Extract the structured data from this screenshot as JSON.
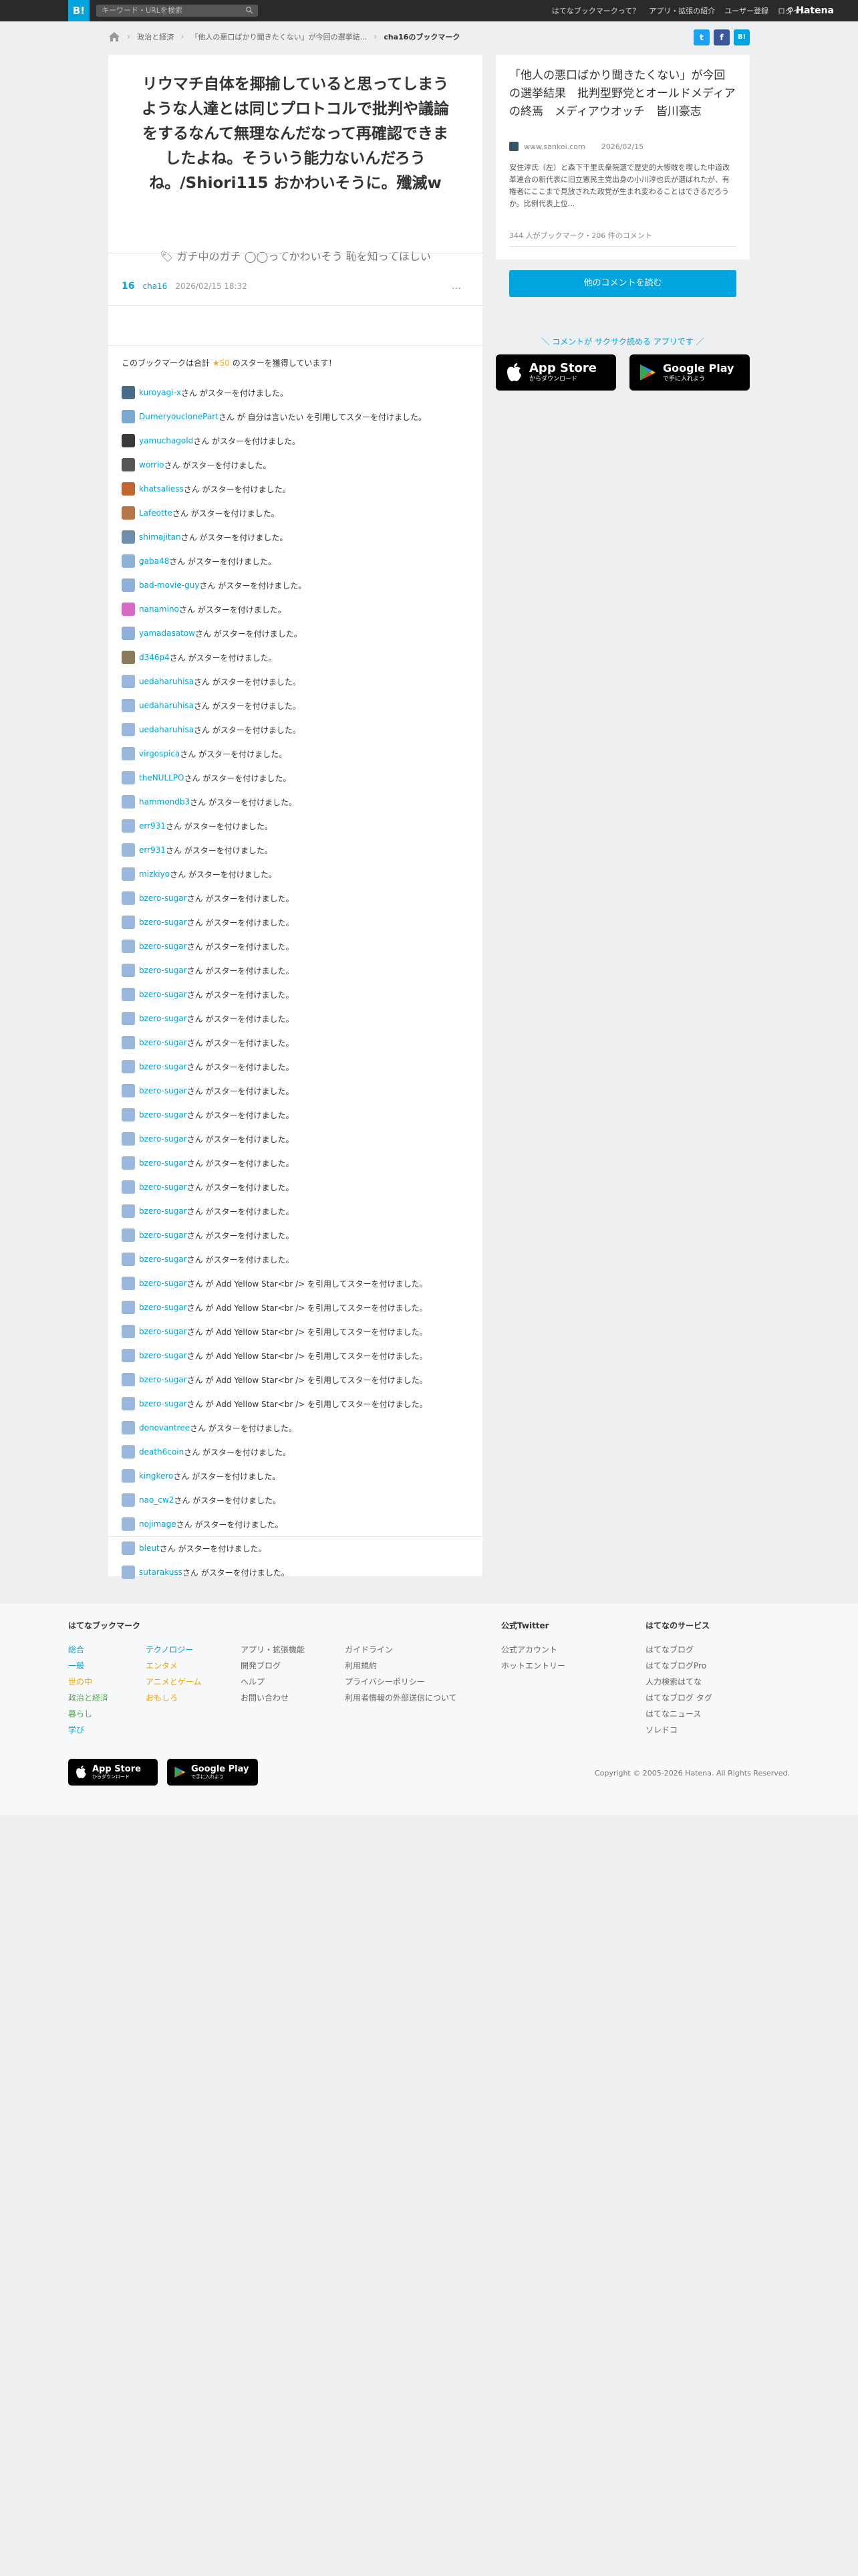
{
  "header": {
    "logo": "B!",
    "search_placeholder": "キーワード・URLを検索",
    "nav": [
      "はてなブックマークって？",
      "アプリ・拡張の紹介",
      "ユーザー登録",
      "ログイン"
    ],
    "brand": "Hatena"
  },
  "breadcrumb": {
    "category": "政治と経済",
    "entry": "「他人の悪口ばかり聞きたくない」が今回の選挙結...",
    "current": "cha16のブックマーク"
  },
  "share": {
    "twitter": "t",
    "facebook": "f",
    "hatena": "B!"
  },
  "bookmark": {
    "comment": "リウマチ自体を揶揄していると思ってしまうような人達とは同じプロトコルで批判や議論をするなんて無理なんだなって再確認できましたよね。そういう能力ないんだろうね。/Shiori115 おかわいそうに。殲滅w",
    "tags": "ガチ中のガチ ◯◯ってかわいそう 恥を知ってほしい",
    "count": "16",
    "user": "cha16",
    "date": "2026/02/15 18:32",
    "more": "…"
  },
  "stars": {
    "summary_prefix": "このブックマークは合計",
    "summary_count": "★50",
    "summary_suffix": "のスターを獲得しています！",
    "rows": [
      {
        "user": "kuroyagi-x",
        "text": "さん がスターを付けました。"
      },
      {
        "user": "DumeryouclonePart",
        "text": "さん が 自分は言いたい を引用してスターを付けました。"
      },
      {
        "user": "yamuchagold",
        "text": "さん がスターを付けました。"
      },
      {
        "user": "worrio",
        "text": "さん がスターを付けました。"
      },
      {
        "user": "khatsaliess",
        "text": "さん がスターを付けました。"
      },
      {
        "user": "Lafeotte",
        "text": "さん がスターを付けました。"
      },
      {
        "user": "shimajitan",
        "text": "さん がスターを付けました。"
      },
      {
        "user": "gaba48",
        "text": "さん がスターを付けました。"
      },
      {
        "user": "bad-movie-guy",
        "text": "さん がスターを付けました。"
      },
      {
        "user": "nanamino",
        "text": "さん がスターを付けました。"
      },
      {
        "user": "yamadasatow",
        "text": "さん がスターを付けました。"
      },
      {
        "user": "d346p4",
        "text": "さん がスターを付けました。"
      },
      {
        "user": "uedaharuhisa",
        "text": "さん がスターを付けました。"
      },
      {
        "user": "uedaharuhisa",
        "text": "さん がスターを付けました。"
      },
      {
        "user": "uedaharuhisa",
        "text": "さん がスターを付けました。"
      },
      {
        "user": "virgospica",
        "text": "さん がスターを付けました。"
      },
      {
        "user": "theNULLPO",
        "text": "さん がスターを付けました。"
      },
      {
        "user": "hammondb3",
        "text": "さん がスターを付けました。"
      },
      {
        "user": "err931",
        "text": "さん がスターを付けました。"
      },
      {
        "user": "err931",
        "text": "さん がスターを付けました。"
      },
      {
        "user": "mizkiyo",
        "text": "さん がスターを付けました。"
      },
      {
        "user": "bzero-sugar",
        "text": "さん がスターを付けました。"
      },
      {
        "user": "bzero-sugar",
        "text": "さん がスターを付けました。"
      },
      {
        "user": "bzero-sugar",
        "text": "さん がスターを付けました。"
      },
      {
        "user": "bzero-sugar",
        "text": "さん がスターを付けました。"
      },
      {
        "user": "bzero-sugar",
        "text": "さん がスターを付けました。"
      },
      {
        "user": "bzero-sugar",
        "text": "さん がスターを付けました。"
      },
      {
        "user": "bzero-sugar",
        "text": "さん がスターを付けました。"
      },
      {
        "user": "bzero-sugar",
        "text": "さん がスターを付けました。"
      },
      {
        "user": "bzero-sugar",
        "text": "さん がスターを付けました。"
      },
      {
        "user": "bzero-sugar",
        "text": "さん がスターを付けました。"
      },
      {
        "user": "bzero-sugar",
        "text": "さん がスターを付けました。"
      },
      {
        "user": "bzero-sugar",
        "text": "さん がスターを付けました。"
      },
      {
        "user": "bzero-sugar",
        "text": "さん がスターを付けました。"
      },
      {
        "user": "bzero-sugar",
        "text": "さん がスターを付けました。"
      },
      {
        "user": "bzero-sugar",
        "text": "さん がスターを付けました。"
      },
      {
        "user": "bzero-sugar",
        "text": "さん がスターを付けました。"
      },
      {
        "user": "bzero-sugar",
        "text": "さん が Add Yellow Star<br /> を引用してスターを付けました。"
      },
      {
        "user": "bzero-sugar",
        "text": "さん が Add Yellow Star<br /> を引用してスターを付けました。"
      },
      {
        "user": "bzero-sugar",
        "text": "さん が Add Yellow Star<br /> を引用してスターを付けました。"
      },
      {
        "user": "bzero-sugar",
        "text": "さん が Add Yellow Star<br /> を引用してスターを付けました。"
      },
      {
        "user": "bzero-sugar",
        "text": "さん が Add Yellow Star<br /> を引用してスターを付けました。"
      },
      {
        "user": "bzero-sugar",
        "text": "さん が Add Yellow Star<br /> を引用してスターを付けました。"
      },
      {
        "user": "donovantree",
        "text": "さん がスターを付けました。"
      },
      {
        "user": "death6coin",
        "text": "さん がスターを付けました。"
      },
      {
        "user": "kingkero",
        "text": "さん がスターを付けました。"
      },
      {
        "user": "nao_cw2",
        "text": "さん がスターを付けました。"
      },
      {
        "user": "nojimage",
        "text": "さん がスターを付けました。"
      },
      {
        "user": "bleut",
        "text": "さん がスターを付けました。"
      },
      {
        "user": "sutarakuss",
        "text": "さん がスターを付けました。"
      }
    ]
  },
  "side": {
    "title": "「他人の悪口ばかり聞きたくない」が今回の選挙結果　批判型野党とオールドメディアの終焉　メディアウオッチ　皆川豪志",
    "domain": "www.sankei.com",
    "date": "2026/02/15",
    "desc": "安住淳氏（左）と森下千里氏衆院選で歴史的大惨敗を喫した中道改革連合の新代表に旧立憲民主党出身の小川淳也氏が選ばれたが、有権者にここまで見放された政党が生まれ変わることはできるだろうか。比例代表上位...",
    "count": "344 人がブックマーク・206 件のコメント",
    "read_button": "他のコメントを読む",
    "app_promo": "＼ コメントが サクサク読める アプリです ／"
  },
  "stores": {
    "apple_big": "App Store",
    "apple_small": "からダウンロード",
    "google_big": "Google Play",
    "google_small": "で手に入れよう"
  },
  "footer": {
    "col1_head": "はてなブックマーク",
    "col1a": [
      "総合",
      "一般",
      "世の中",
      "政治と経済",
      "暮らし",
      "学び"
    ],
    "col1b": [
      "テクノロジー",
      "エンタメ",
      "アニメとゲーム",
      "おもしろ"
    ],
    "col2": [
      "アプリ・拡張機能",
      "開発ブログ",
      "ヘルプ",
      "お問い合わせ"
    ],
    "col3": [
      "ガイドライン",
      "利用規約",
      "プライバシーポリシー",
      "利用者情報の外部送信について"
    ],
    "col4_head": "公式Twitter",
    "col4": [
      "公式アカウント",
      "ホットエントリー"
    ],
    "col5_head": "はてなのサービス",
    "col5": [
      "はてなブログ",
      "はてなブログPro",
      "人力検索はてな",
      "はてなブログ タグ",
      "はてなニュース",
      "ソレドコ"
    ],
    "copyright": "Copyright © 2005-2026 Hatena. All Rights Reserved."
  },
  "colors": {
    "accent": "#00a4de",
    "star": "#f5a623",
    "twitter": "#1da1f2",
    "facebook": "#3b5998"
  }
}
